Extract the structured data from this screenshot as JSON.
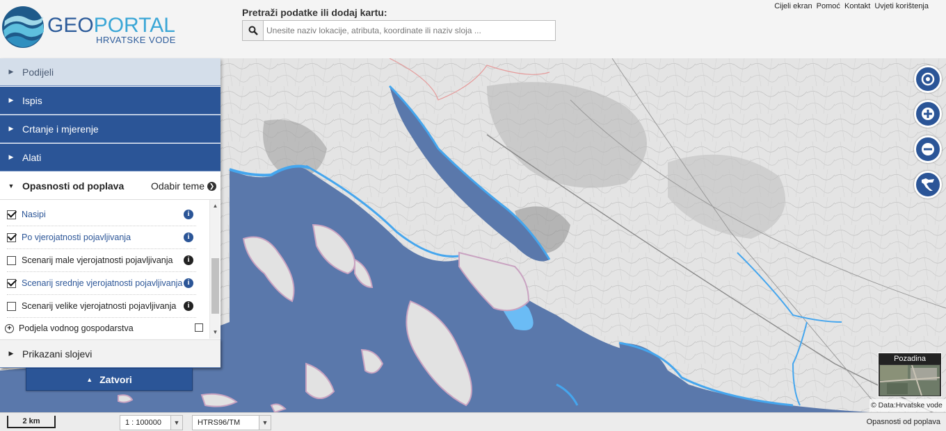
{
  "header": {
    "logo_main_a": "GEO",
    "logo_main_b": "PORTAL",
    "logo_sub": "HRVATSKE VODE",
    "search_label": "Pretraži podatke ili dodaj kartu:",
    "search_placeholder": "Unesite naziv lokacije, atributa, koordinate ili naziv sloja ...",
    "links": [
      "Cijeli ekran",
      "Pomoć",
      "Kontakt",
      "Uvjeti korištenja"
    ]
  },
  "panel": {
    "sections": [
      {
        "label": "Podijeli"
      },
      {
        "label": "Ispis"
      },
      {
        "label": "Crtanje i mjerenje"
      },
      {
        "label": "Alati"
      }
    ],
    "theme": {
      "label": "Opasnosti od poplava",
      "link": "Odabir teme"
    },
    "layers": [
      {
        "label": "Nasipi",
        "checked": true
      },
      {
        "label": "Po vjerojatnosti pojavljivanja",
        "checked": true
      },
      {
        "label": "Scenarij male vjerojatnosti pojavljivanja",
        "checked": false
      },
      {
        "label": "Scenarij srednje vjerojatnosti pojavljivanja",
        "checked": true
      },
      {
        "label": "Scenarij velike vjerojatnosti pojavljivanja",
        "checked": false
      }
    ],
    "group": {
      "label": "Podjela vodnog gospodarstva",
      "checked": false
    },
    "shown_layers": "Prikazani slojevi",
    "close": "Zatvori"
  },
  "map": {
    "background_label": "Pozadina",
    "attribution": "© Data:Hrvatske vode"
  },
  "status": {
    "scale_bar": "2 km",
    "scale": "1 : 100000",
    "crs": "HTRS96/TM",
    "layer": "Opasnosti od poplava"
  },
  "colors": {
    "primary": "#2b5597",
    "sea": "#5a78ab",
    "flood": "#45a6ee"
  }
}
